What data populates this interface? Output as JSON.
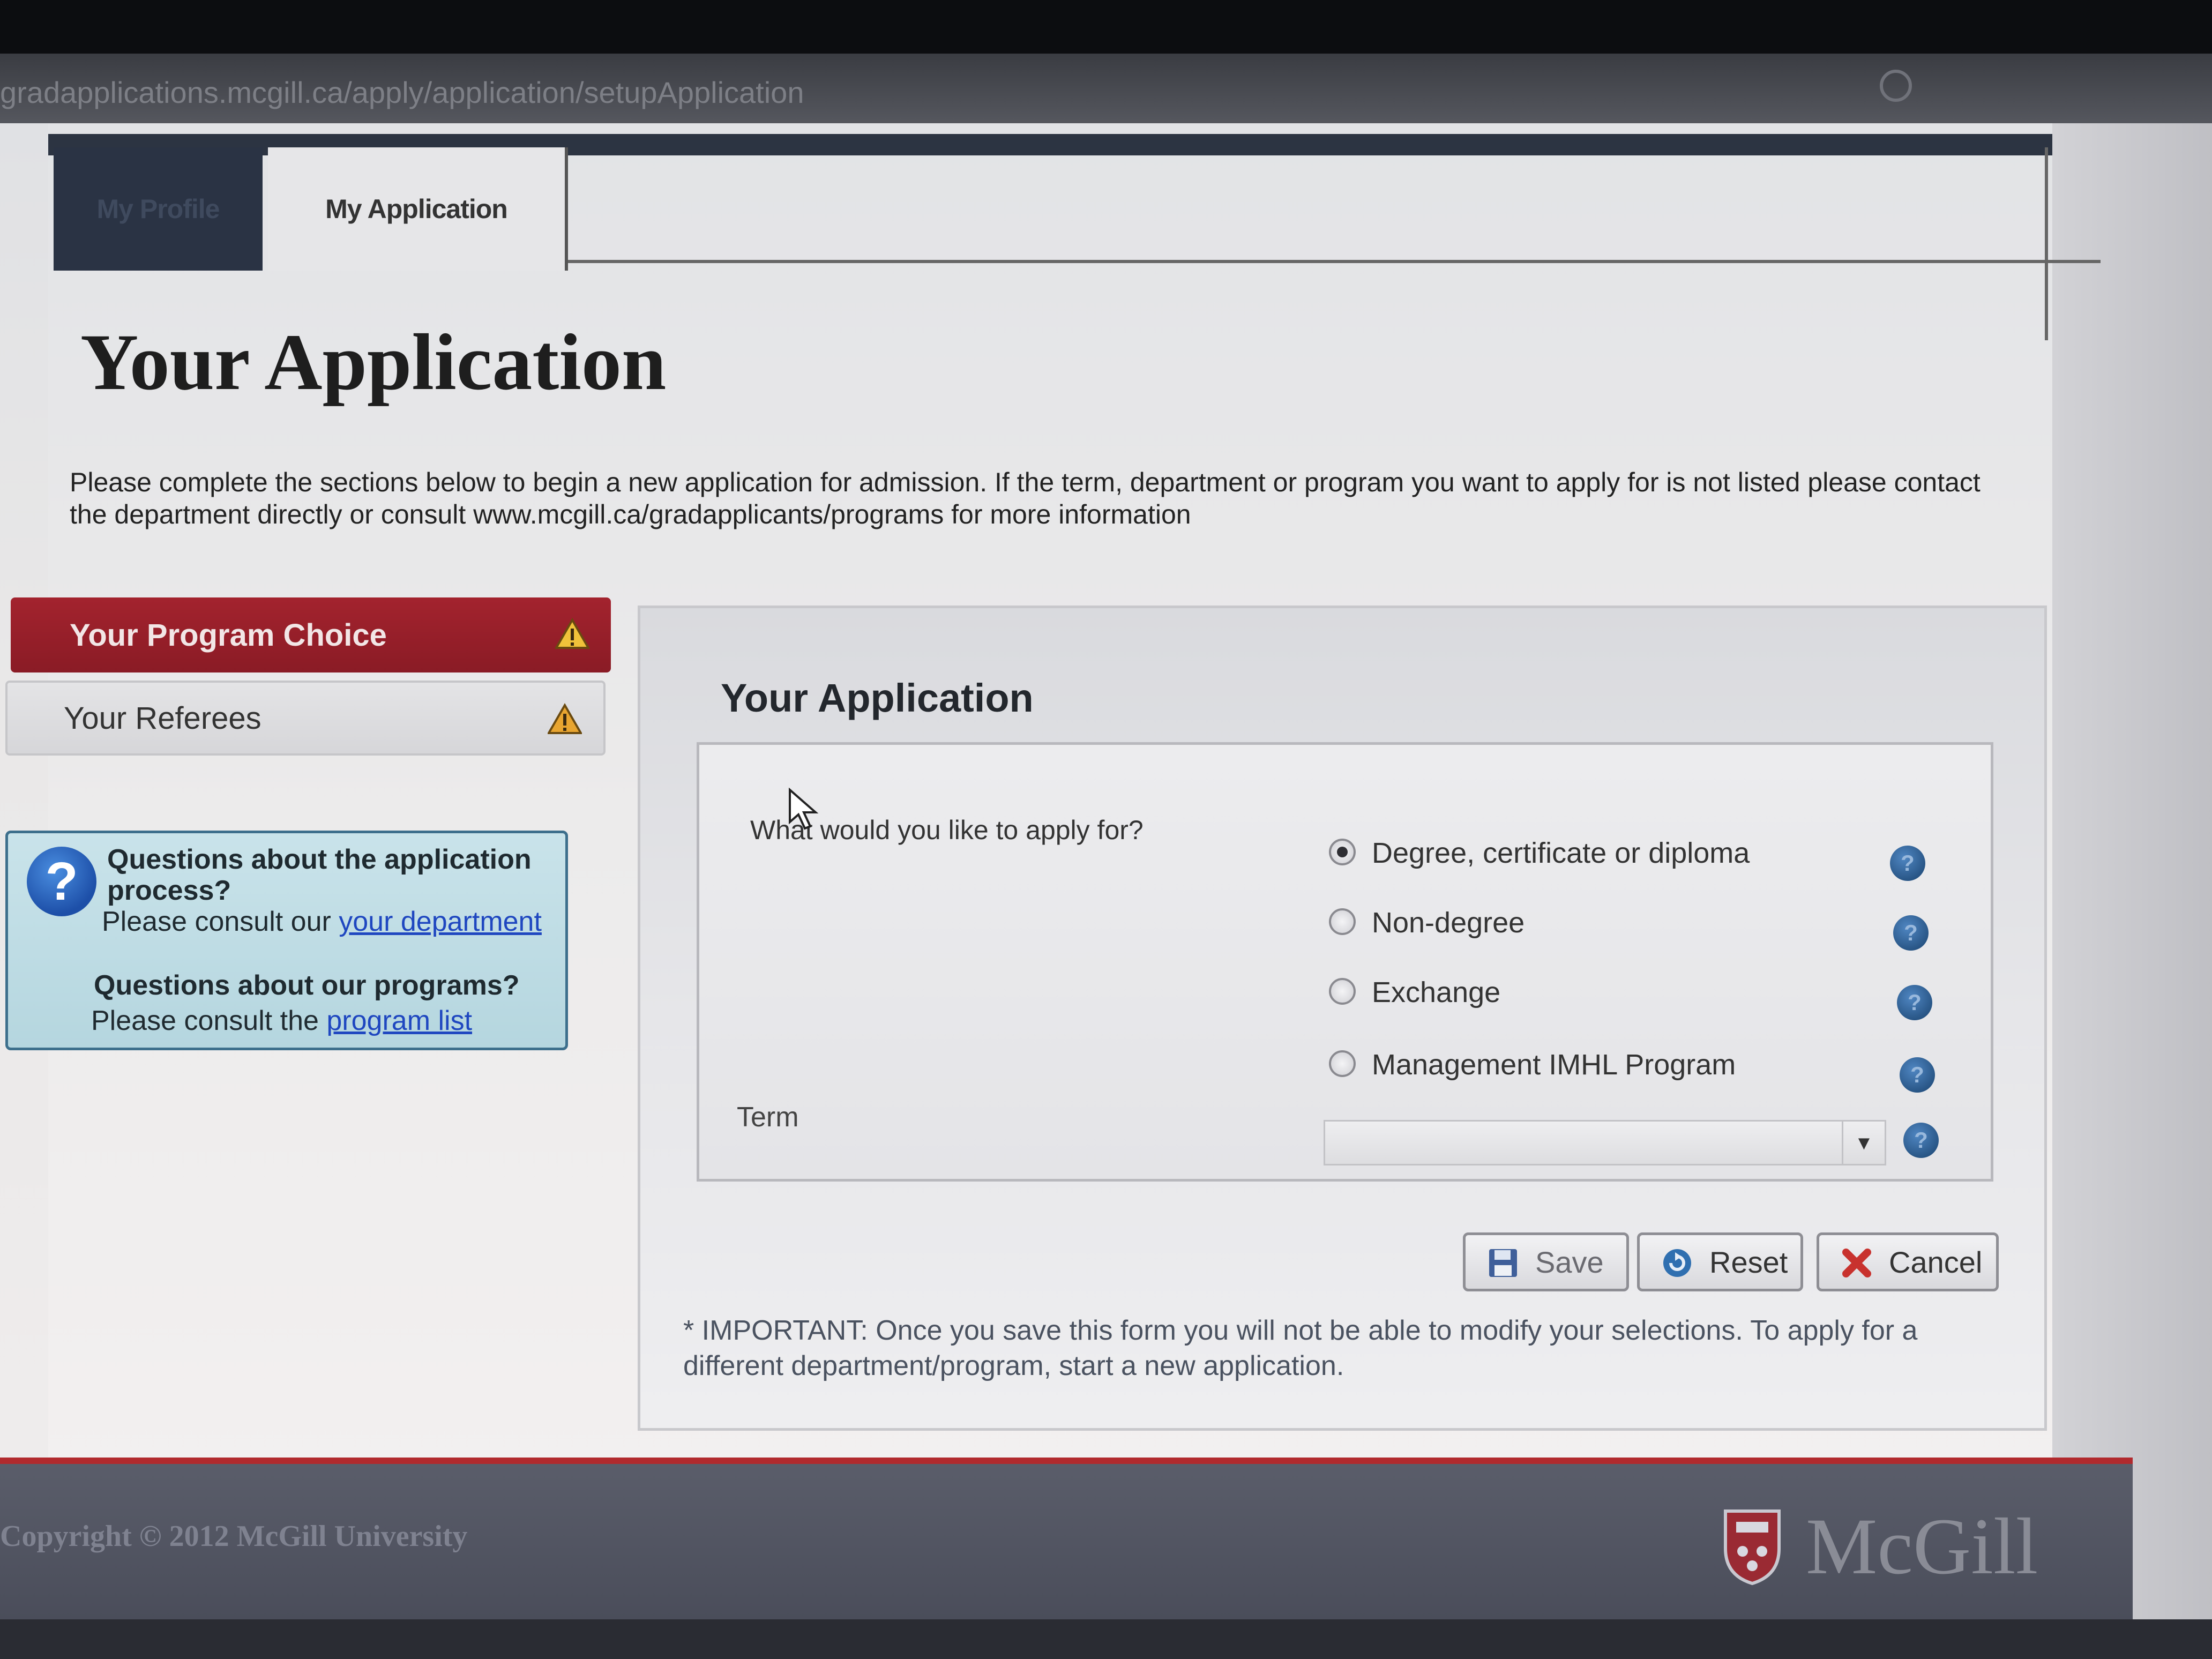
{
  "browser": {
    "url": "gradapplications.mcgill.ca/apply/application/setupApplication"
  },
  "tabs": [
    {
      "label": "My Profile"
    },
    {
      "label": "My Application"
    }
  ],
  "page": {
    "title": "Your Application",
    "intro": "Please complete the sections below to begin a new application for admission. If the term, department or program you want to apply for is not listed please contact the department directly or consult www.mcgill.ca/gradapplicants/programs for more information"
  },
  "sidebar": {
    "items": [
      {
        "label": "Your Program Choice",
        "icon": "warning-icon"
      },
      {
        "label": "Your Referees",
        "icon": "warning-icon"
      }
    ]
  },
  "help": {
    "q1": "Questions about the application process?",
    "p1_prefix": "Please consult our ",
    "p1_link": "your department",
    "q2": "Questions about our programs?",
    "p2_prefix": "Please consult the ",
    "p2_link": "program list"
  },
  "form": {
    "title": "Your Application",
    "question": "What would you like to apply for?",
    "options": [
      {
        "label": "Degree, certificate or diploma",
        "checked": true
      },
      {
        "label": "Non-degree",
        "checked": false
      },
      {
        "label": "Exchange",
        "checked": false
      },
      {
        "label": "Management IMHL Program",
        "checked": false
      }
    ],
    "term_label": "Term",
    "term_value": "",
    "help_glyph": "?"
  },
  "buttons": {
    "save": "Save",
    "reset": "Reset",
    "cancel": "Cancel"
  },
  "notice": "* IMPORTANT: Once you save this form you will not be able to modify your selections. To apply for a different department/program, start a new application.",
  "footer": {
    "copyright": "Copyright © 2012 McGill University",
    "logo": "McGill"
  },
  "colors": {
    "brand_red": "#a3232e",
    "link_blue": "#1f47c0",
    "help_blue": "#24507f"
  }
}
